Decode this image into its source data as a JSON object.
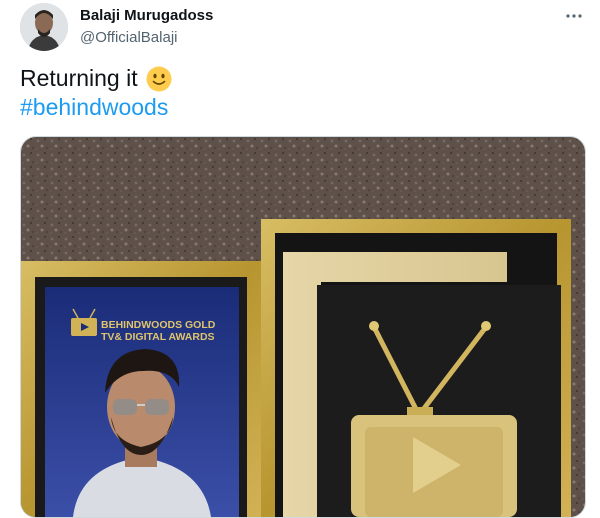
{
  "author": {
    "display_name": "Balaji Murugadoss",
    "handle": "@OfficialBalaji"
  },
  "tweet": {
    "text": "Returning it",
    "emoji": "slightly-smiling-face",
    "hashtag": "#behindwoods"
  },
  "media": {
    "award_logo_line1": "BEHINDWOODS GOLD",
    "award_logo_line2": "TV& DIGITAL AWARDS"
  },
  "icons": {
    "more": "more-horizontal-icon"
  },
  "colors": {
    "link": "#1d9bf0",
    "secondary_text": "#536471",
    "gold": "#c9a93d"
  }
}
